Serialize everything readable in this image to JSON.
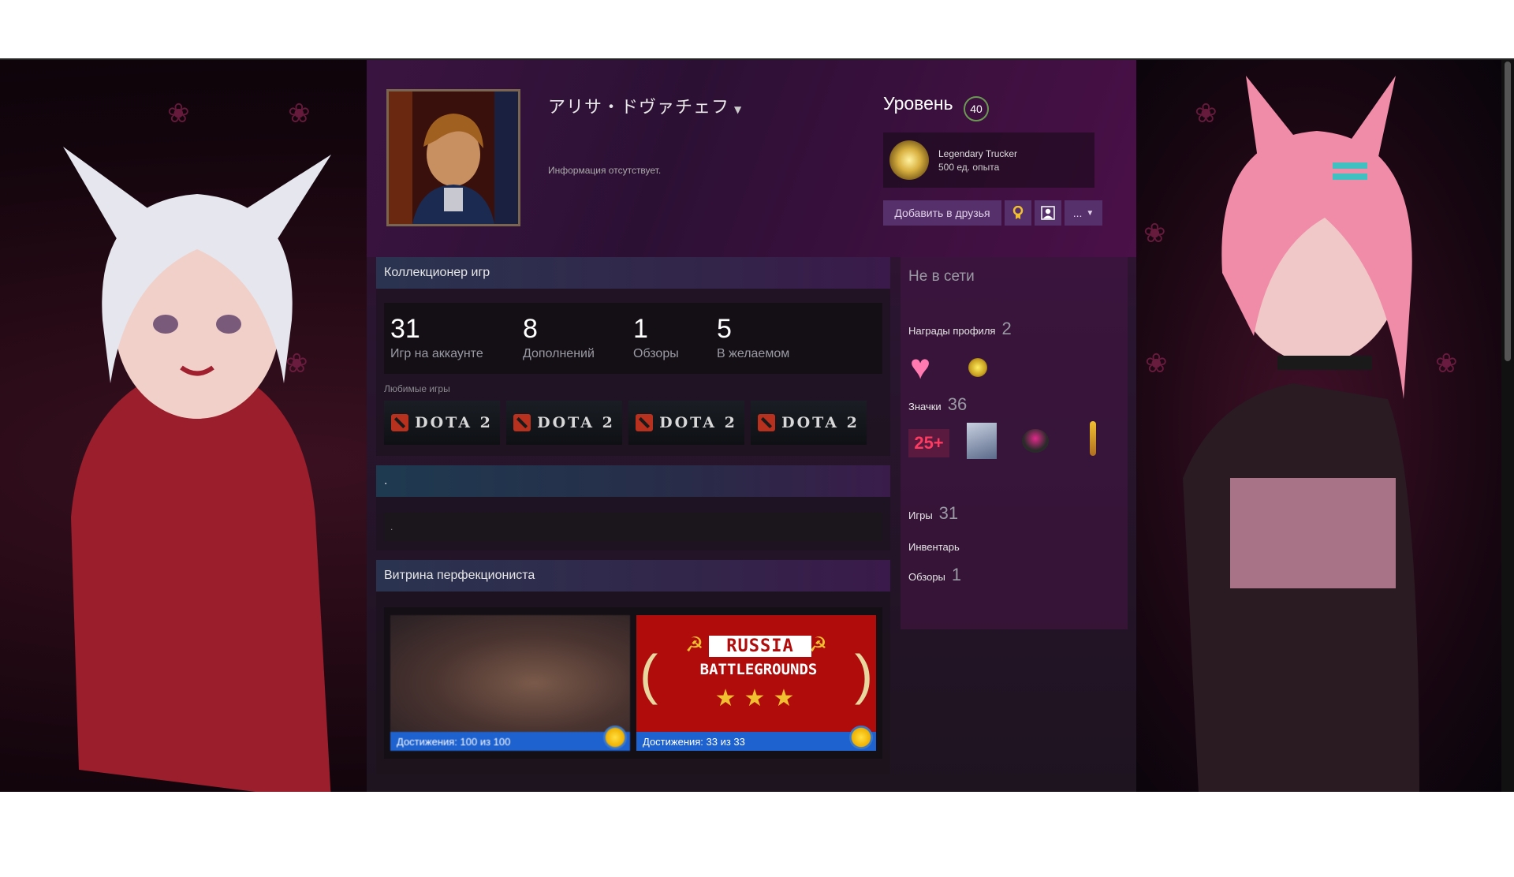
{
  "profile": {
    "persona_name": "アリサ・ドヴァチェフ",
    "summary": "Информация отсутствует.",
    "level_label": "Уровень",
    "level": "40",
    "favorite_badge": {
      "name": "Legendary Trucker",
      "xp": "500 ед. опыта"
    },
    "actions": {
      "add_friend": "Добавить в друзья",
      "more": "..."
    }
  },
  "game_collector": {
    "title": "Коллекционер игр",
    "stats": [
      {
        "value": "31",
        "label": "Игр на аккаунте"
      },
      {
        "value": "8",
        "label": "Дополнений"
      },
      {
        "value": "1",
        "label": "Обзоры"
      },
      {
        "value": "5",
        "label": "В желаемом"
      }
    ],
    "favorites_label": "Любимые игры",
    "favorite_games": [
      "DOTA 2",
      "DOTA 2",
      "DOTA 2",
      "DOTA 2"
    ]
  },
  "custom_box": {
    "title": ".",
    "text": "."
  },
  "perfectionist": {
    "title": "Витрина перфекциониста",
    "items": [
      {
        "progress": "Достижения: 100 из 100"
      },
      {
        "progress": "Достижения: 33 из 33",
        "title_line1": "RUSSIA",
        "title_line2": "BATTLEGROUNDS"
      }
    ]
  },
  "sidebar": {
    "status": "Не в сети",
    "awards_label": "Награды профиля",
    "awards_count": "2",
    "badges_label": "Значки",
    "badges_count": "36",
    "badge_25_text": "25+",
    "games_label": "Игры",
    "games_count": "31",
    "inventory_label": "Инвентарь",
    "reviews_label": "Обзоры",
    "reviews_count": "1"
  }
}
